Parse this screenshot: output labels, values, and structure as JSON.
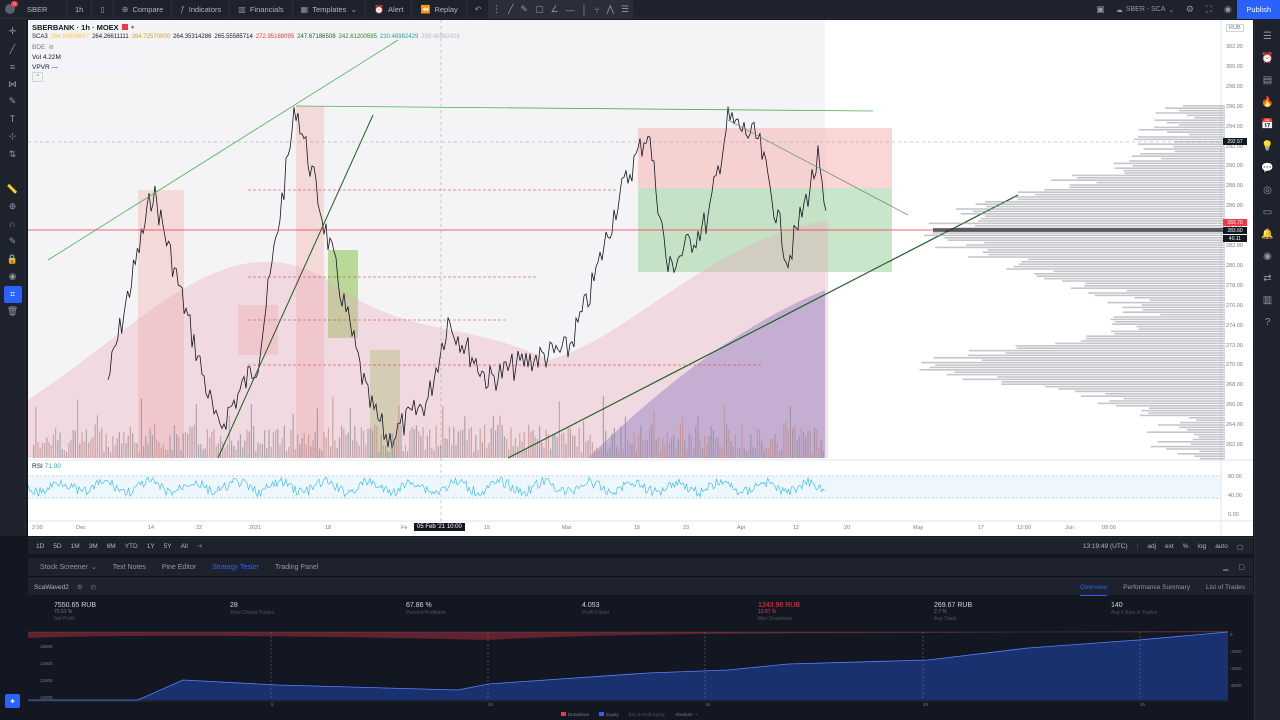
{
  "topbar": {
    "notifications": "11",
    "symbol": "SBER",
    "interval": "1h",
    "compare": "Compare",
    "indicators": "Indicators",
    "financials": "Financials",
    "templates": "Templates",
    "alert": "Alert",
    "replay": "Replay",
    "layout_name": "SBER - SCA",
    "publish": "Publish"
  },
  "legend": {
    "title": "SBERBANK · 1h · MOEX",
    "sca_label": "SCA3",
    "sca_values": [
      "264.99866667",
      "264.26611111",
      "264.72570000",
      "264.35314286",
      "265.55585714",
      "272.95188095",
      "247.67186508",
      "242.61200595",
      "230.48982429",
      "258.48982429"
    ],
    "sca_colors": [
      "#f7c948",
      "#131722",
      "#c9a227",
      "#131722",
      "#131722",
      "#e53935",
      "#1b5e20",
      "#2e7d32",
      "#26a69a",
      "#b0bec5"
    ],
    "bde": "BDE",
    "vol": "Vol  4.22M",
    "vpvr": "VPVR  ---"
  },
  "rsi": {
    "label": "RSI",
    "value": "71.00"
  },
  "axis": {
    "price_ticks": [
      "302.00",
      "300.00",
      "298.00",
      "296.00",
      "294.00",
      "292.00",
      "290.00",
      "288.00",
      "286.00",
      "284.00",
      "282.00",
      "280.00",
      "278.00",
      "276.00",
      "274.00",
      "272.00",
      "270.00",
      "268.00",
      "266.00",
      "264.00",
      "262.00"
    ],
    "rsi_ticks": [
      "80.00",
      "40.00",
      "0.00"
    ],
    "currency": "RUB",
    "tag_crosshair": "292.57",
    "tag_red": "283.70",
    "tag_dark": "283.60",
    "tag_dark2": "40.11",
    "time_ticks": [
      {
        "t": "2:00",
        "x": 4
      },
      {
        "t": "Dec",
        "x": 48
      },
      {
        "t": "14",
        "x": 120
      },
      {
        "t": "22",
        "x": 168
      },
      {
        "t": "2021",
        "x": 221
      },
      {
        "t": "18",
        "x": 297
      },
      {
        "t": "Fe",
        "x": 373
      },
      {
        "t": "15",
        "x": 456
      },
      {
        "t": "Mar",
        "x": 534
      },
      {
        "t": "15",
        "x": 606
      },
      {
        "t": "23",
        "x": 655
      },
      {
        "t": "Apr",
        "x": 709
      },
      {
        "t": "12",
        "x": 765
      },
      {
        "t": "20",
        "x": 816
      },
      {
        "t": "May",
        "x": 885
      },
      {
        "t": "17",
        "x": 950
      },
      {
        "t": "12:00",
        "x": 989
      },
      {
        "t": "Jun",
        "x": 1037
      },
      {
        "t": "09:00",
        "x": 1074
      }
    ],
    "crosshair_time": "05 Feb '21   10:00"
  },
  "timeframes": [
    "1D",
    "5D",
    "1M",
    "3M",
    "6M",
    "YTD",
    "1Y",
    "5Y",
    "All"
  ],
  "timebar_right": {
    "clock": "13:19:49 (UTC)",
    "adj": "adj",
    "ext": "ext",
    "pct": "%",
    "log": "log",
    "auto": "auto"
  },
  "panel_tabs": [
    "Stock Screener",
    "Text Notes",
    "Pine Editor",
    "Strategy Tester",
    "Trading Panel"
  ],
  "strategy": {
    "name": "ScaWaved2",
    "tabs": [
      "Overview",
      "Performance Summary",
      "List of Trades"
    ]
  },
  "stats": [
    {
      "value": "7550.65 RUB",
      "sub": "75.51 %",
      "label": "Net Profit",
      "neg": false,
      "x": 26
    },
    {
      "value": "28",
      "sub": "",
      "label": "Total Closed Trades",
      "neg": false,
      "x": 202
    },
    {
      "value": "67.86 %",
      "sub": "",
      "label": "Percent Profitable",
      "neg": false,
      "x": 378
    },
    {
      "value": "4.053",
      "sub": "",
      "label": "Profit Factor",
      "neg": false,
      "x": 554
    },
    {
      "value": "1243.98 RUB",
      "sub": "10.87 %",
      "label": "Max Drawdown",
      "neg": true,
      "x": 730
    },
    {
      "value": "269.67 RUB",
      "sub": "2.7 %",
      "label": "Avg Trade",
      "neg": false,
      "x": 906
    },
    {
      "value": "140",
      "sub": "",
      "label": "Avg # Bars in Trades",
      "neg": false,
      "x": 1083
    }
  ],
  "equity": {
    "legend": [
      "Drawdown",
      "Equity",
      "Buy & Hold Equity",
      "Absolute"
    ],
    "left_ticks": [
      "16000",
      "14000",
      "12000",
      "10000"
    ],
    "right_ticks": [
      "0",
      "-2000",
      "-4000",
      "-6000"
    ],
    "x_ticks": [
      {
        "t": "5",
        "x": 243
      },
      {
        "t": "10",
        "x": 460
      },
      {
        "t": "15",
        "x": 677
      },
      {
        "t": "20",
        "x": 895
      },
      {
        "t": "25",
        "x": 1112
      }
    ]
  },
  "colors": {
    "accent": "#2962ff",
    "bg": "#131722",
    "panel": "#1e222d",
    "up": "#26a69a",
    "down": "#f23645"
  }
}
